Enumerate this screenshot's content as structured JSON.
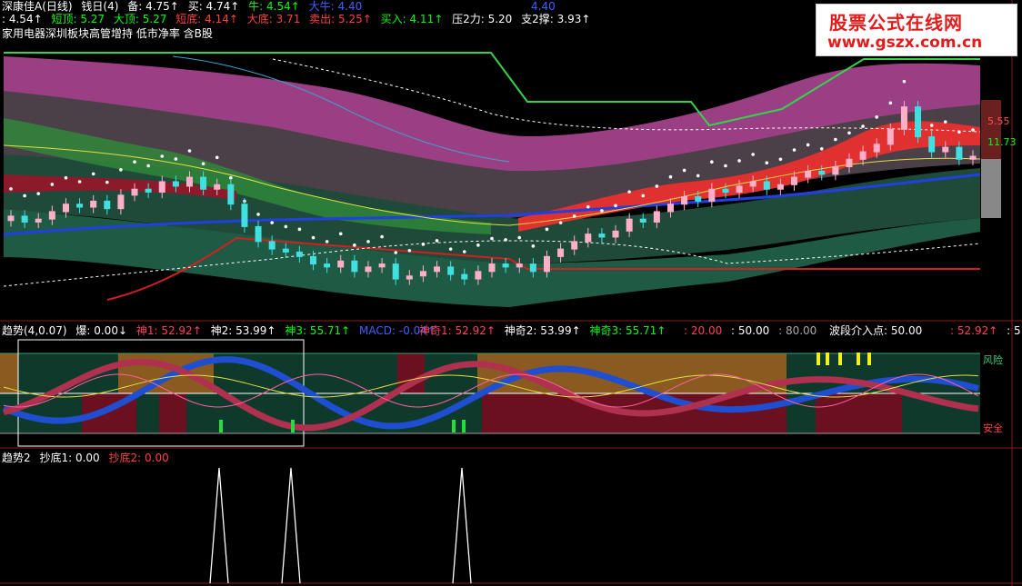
{
  "main_header": {
    "line1": [
      {
        "text": "深康佳A(日线)",
        "color": "#ffffff"
      },
      {
        "text": "钱日(4)",
        "color": "#ffffff"
      },
      {
        "text": "备: 4.75↑",
        "color": "#ffffff"
      },
      {
        "text": "买: 4.74↑",
        "color": "#ffffff"
      },
      {
        "text": "牛: 4.54↑",
        "color": "#00ff00"
      },
      {
        "text": "大牛: 4.40",
        "color": "#4060ff"
      },
      {
        "text": "4.40",
        "color": "#4060ff"
      }
    ],
    "line2": [
      {
        "text": ": 4.54↑",
        "color": "#ffffff"
      },
      {
        "text": "短顶: 5.27",
        "color": "#00ff00"
      },
      {
        "text": "大顶: 5.27",
        "color": "#00ff00"
      },
      {
        "text": "短底: 4.14↑",
        "color": "#ff4040"
      },
      {
        "text": "大底: 3.71",
        "color": "#ff4040"
      },
      {
        "text": "卖出: 5.25↑",
        "color": "#ff4040"
      },
      {
        "text": "买入: 4.11↑",
        "color": "#00ff00"
      },
      {
        "text": "压2力: 5.20",
        "color": "#ffffff"
      },
      {
        "text": "支2撑: 3.93↑",
        "color": "#ffffff"
      }
    ],
    "line3": "家用电器深圳板块高管增持 低市净率 含B股",
    "axis_labels": [
      {
        "text": "5.55",
        "color": "#ff5050"
      },
      {
        "text": "11.73",
        "color": "#00ff00"
      }
    ]
  },
  "indicator_header": [
    {
      "text": "趋势(4,0.07)",
      "color": "#ffffff"
    },
    {
      "text": "爆: 0.00↓",
      "color": "#ffffff"
    },
    {
      "text": "神1: 52.92↑",
      "color": "#ff4060"
    },
    {
      "text": "神2: 53.99↑",
      "color": "#ffffff"
    },
    {
      "text": "神3: 55.71↑",
      "color": "#00ff00"
    },
    {
      "text": "MACD: -0.04↑",
      "color": "#4060ff"
    },
    {
      "text": "神奇1: 52.92↑",
      "color": "#ff4060"
    },
    {
      "text": "神奇2: 53.99↑",
      "color": "#ffffff"
    },
    {
      "text": "神奇3: 55.71↑",
      "color": "#00ff00"
    },
    {
      "text": ": 20.00",
      "color": "#ff4060"
    },
    {
      "text": ": 50.00",
      "color": "#ffffff"
    },
    {
      "text": ": 80.00",
      "color": "#aaaaaa"
    },
    {
      "text": "波段介入点: 50.00",
      "color": "#ffffff"
    },
    {
      "text": ": 52.92↑",
      "color": "#ff4060"
    },
    {
      "text": ": 5",
      "color": "#ffffff"
    }
  ],
  "indicator_labels": {
    "risk": "风险",
    "safe": "安全"
  },
  "bottom_header": [
    {
      "text": "趋势2",
      "color": "#ffffff"
    },
    {
      "text": "抄底1: 0.00",
      "color": "#ffffff"
    },
    {
      "text": "抄底2: 0.00",
      "color": "#ff4040"
    }
  ],
  "watermark": {
    "line1": "股票公式在线网",
    "line2": "www.gszx.com.cn"
  },
  "chart_data": {
    "type": "line",
    "candles": {
      "close": [
        4.52,
        4.48,
        4.5,
        4.55,
        4.6,
        4.58,
        4.62,
        4.57,
        4.66,
        4.7,
        4.68,
        4.75,
        4.72,
        4.78,
        4.7,
        4.73,
        4.6,
        4.45,
        4.35,
        4.3,
        4.28,
        4.25,
        4.2,
        4.18,
        4.22,
        4.15,
        4.18,
        4.2,
        4.1,
        4.12,
        4.15,
        4.18,
        4.13,
        4.1,
        4.15,
        4.2,
        4.18,
        4.2,
        4.15,
        4.25,
        4.3,
        4.35,
        4.4,
        4.38,
        4.42,
        4.5,
        4.48,
        4.55,
        4.6,
        4.65,
        4.62,
        4.7,
        4.68,
        4.72,
        4.75,
        4.7,
        4.73,
        4.78,
        4.82,
        4.8,
        4.85,
        4.9,
        4.95,
        5.0,
        5.1,
        5.25,
        5.05,
        4.95,
        4.98,
        4.9,
        4.92
      ]
    },
    "bottom_signals": [
      241,
      320,
      508
    ]
  }
}
